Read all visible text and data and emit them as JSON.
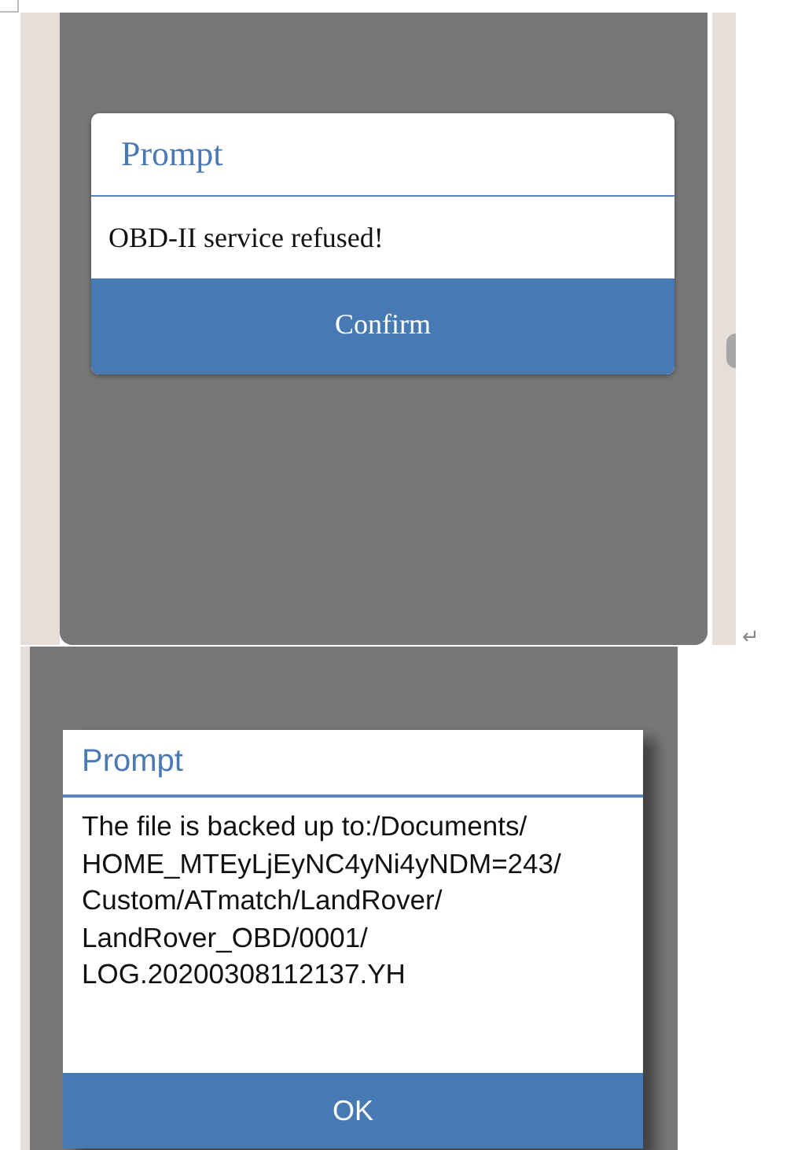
{
  "screenshots": [
    {
      "dialog": {
        "title": "Prompt",
        "message": "OBD-II service refused!",
        "button": "Confirm"
      }
    },
    {
      "dialog": {
        "title": "Prompt",
        "message": "The file is backed up to:/Documents/\nHOME_MTEyLjEyNC4yNi4yNDM=243/\nCustom/ATmatch/LandRover/\nLandRover_OBD/0001/\nLOG.20200308112137.YH",
        "button": "OK"
      }
    }
  ],
  "paragraph_mark": "↵"
}
